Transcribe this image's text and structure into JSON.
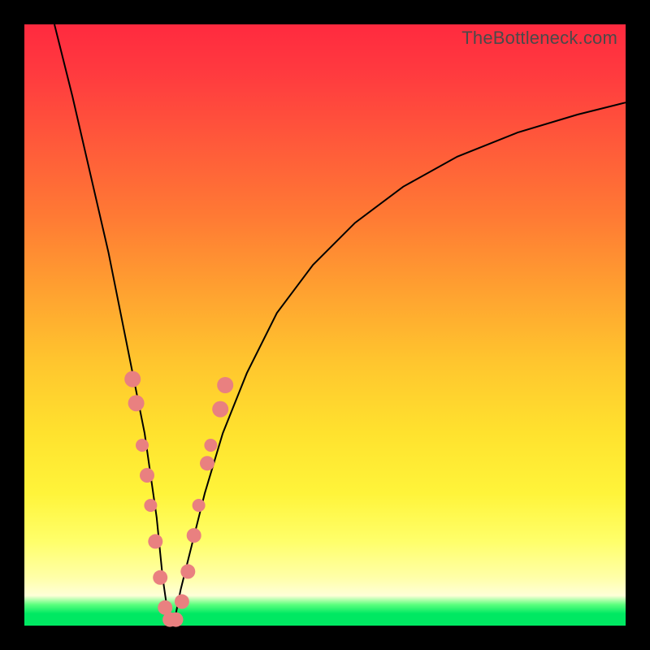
{
  "watermark": "TheBottleneck.com",
  "colors": {
    "frame": "#000000",
    "gradient_top": "#ff2a3f",
    "gradient_mid": "#ffe22e",
    "gradient_bottom_band": "#00e862",
    "curve": "#000000",
    "beads": "#e98080"
  },
  "chart_data": {
    "type": "line",
    "title": "",
    "xlabel": "",
    "ylabel": "",
    "xlim": [
      0,
      100
    ],
    "ylim": [
      0,
      100
    ],
    "note": "Axes are unlabeled; values are normalized 0–100. y increases upward (0 at bottom green band, 100 at top red). Curve is a V-shaped bottleneck profile with minimum near x≈24, y≈0.",
    "series": [
      {
        "name": "bottleneck-curve",
        "x": [
          5,
          8,
          11,
          14,
          16,
          18,
          20,
          22,
          23,
          24,
          25,
          26,
          28,
          30,
          33,
          37,
          42,
          48,
          55,
          63,
          72,
          82,
          92,
          100
        ],
        "y": [
          100,
          88,
          75,
          62,
          52,
          42,
          32,
          18,
          8,
          1,
          1,
          6,
          14,
          22,
          32,
          42,
          52,
          60,
          67,
          73,
          78,
          82,
          85,
          87
        ]
      }
    ],
    "beads": {
      "name": "highlight-points",
      "note": "Salmon-pink rounded markers clustered on both flanks near the curve minimum.",
      "points": [
        {
          "x": 18.0,
          "y": 41,
          "r": 10
        },
        {
          "x": 18.6,
          "y": 37,
          "r": 10
        },
        {
          "x": 19.6,
          "y": 30,
          "r": 8
        },
        {
          "x": 20.4,
          "y": 25,
          "r": 9
        },
        {
          "x": 21.0,
          "y": 20,
          "r": 8
        },
        {
          "x": 21.8,
          "y": 14,
          "r": 9
        },
        {
          "x": 22.6,
          "y": 8,
          "r": 9
        },
        {
          "x": 23.4,
          "y": 3,
          "r": 9
        },
        {
          "x": 24.2,
          "y": 1,
          "r": 9
        },
        {
          "x": 25.2,
          "y": 1,
          "r": 9
        },
        {
          "x": 26.2,
          "y": 4,
          "r": 9
        },
        {
          "x": 27.2,
          "y": 9,
          "r": 9
        },
        {
          "x": 28.2,
          "y": 15,
          "r": 9
        },
        {
          "x": 29.0,
          "y": 20,
          "r": 8
        },
        {
          "x": 30.4,
          "y": 27,
          "r": 9
        },
        {
          "x": 31.0,
          "y": 30,
          "r": 8
        },
        {
          "x": 32.6,
          "y": 36,
          "r": 10
        },
        {
          "x": 33.4,
          "y": 40,
          "r": 10
        }
      ]
    }
  }
}
